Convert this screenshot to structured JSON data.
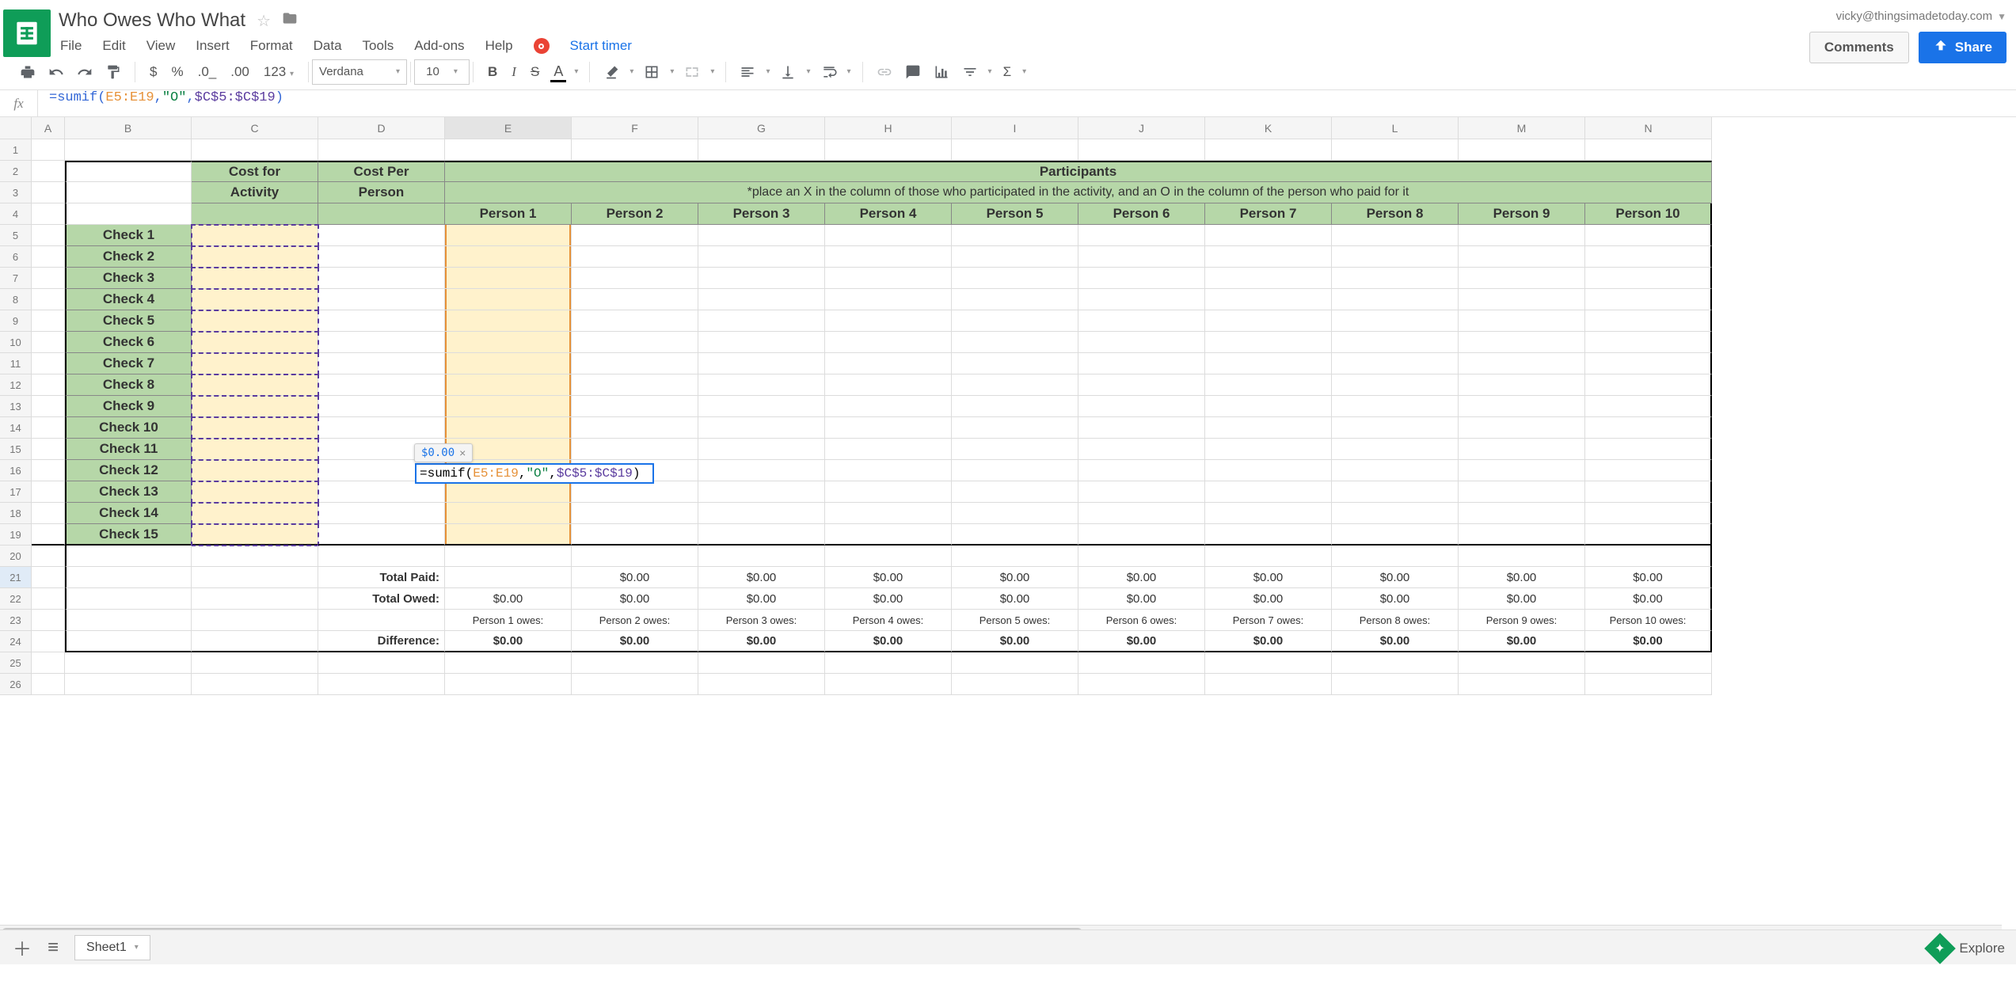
{
  "doc_title": "Who Owes Who What",
  "user_email": "vicky@thingsimadetoday.com",
  "comments_btn": "Comments",
  "share_btn": "Share",
  "menus": [
    "File",
    "Edit",
    "View",
    "Insert",
    "Format",
    "Data",
    "Tools",
    "Add-ons",
    "Help"
  ],
  "timer": "Start timer",
  "font": "Verdana",
  "font_size": "10",
  "number_fmt": "123",
  "formula_bar": "=sumif(E5:E19,\"O\",$C$5:$C$19)",
  "cols": [
    "A",
    "B",
    "C",
    "D",
    "E",
    "F",
    "G",
    "H",
    "I",
    "J",
    "K",
    "L",
    "M",
    "N"
  ],
  "rows": [
    "1",
    "2",
    "3",
    "4",
    "5",
    "6",
    "7",
    "8",
    "9",
    "10",
    "11",
    "12",
    "13",
    "14",
    "15",
    "16",
    "17",
    "18",
    "19",
    "20",
    "21",
    "22",
    "23",
    "24",
    "25",
    "26"
  ],
  "headers": {
    "participants": "Participants",
    "instruction": "*place an X in the column of those who participated in the activity, and an O in the column of the person who paid for it",
    "cost_activity_1": "Cost for",
    "cost_activity_2": "Activity",
    "cost_person_1": "Cost Per",
    "cost_person_2": "Person",
    "persons": [
      "Person 1",
      "Person 2",
      "Person 3",
      "Person 4",
      "Person 5",
      "Person 6",
      "Person 7",
      "Person 8",
      "Person 9",
      "Person 10"
    ]
  },
  "checks": [
    "Check 1",
    "Check 2",
    "Check 3",
    "Check 4",
    "Check 5",
    "Check 6",
    "Check 7",
    "Check 8",
    "Check 9",
    "Check 10",
    "Check 11",
    "Check 12",
    "Check 13",
    "Check 14",
    "Check 15"
  ],
  "summary": {
    "total_paid": "Total Paid:",
    "total_owed": "Total Owed:",
    "difference": "Difference:",
    "zero": "$0.00",
    "owes_labels": [
      "Person 1 owes:",
      "Person 2 owes:",
      "Person 3 owes:",
      "Person 4 owes:",
      "Person 5 owes:",
      "Person 6 owes:",
      "Person 7 owes:",
      "Person 8 owes:",
      "Person 9 owes:",
      "Person 10 owes:"
    ]
  },
  "edit": {
    "pre": "=sumif(",
    "range1": "E5:E19",
    "comma1": ",",
    "quote": "\"O\"",
    "comma2": ",",
    "range2": "$C$5:$C$19",
    "close": ")",
    "hint": "$0.00"
  },
  "footer": {
    "sheet": "Sheet1",
    "explore": "Explore"
  }
}
